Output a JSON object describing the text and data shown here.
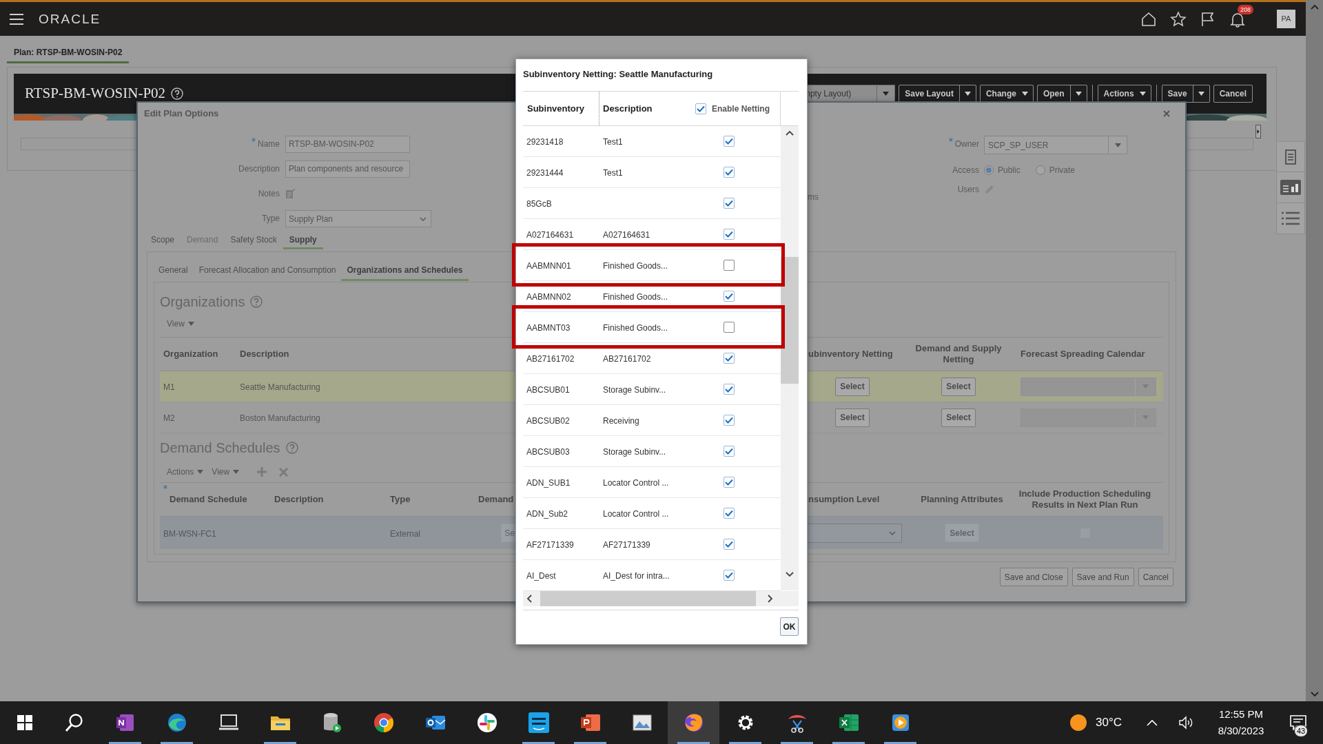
{
  "top_bar": {
    "logo": "ORACLE",
    "notification_count": "208",
    "avatar": "PA"
  },
  "page_tab": {
    "label": "Plan: RTSP-BM-WOSIN-P02",
    "selected": true
  },
  "plan_header": {
    "title": "RTSP-BM-WOSIN-P02",
    "layout_select": "npty Layout)",
    "buttons": [
      {
        "label": "Save Layout",
        "kind": "split",
        "separator_before": false
      },
      {
        "label": "Change",
        "kind": "menu",
        "separator_before": false
      },
      {
        "label": "Open",
        "kind": "split",
        "separator_before": false
      },
      {
        "label": "Actions",
        "kind": "menu",
        "separator_before": true
      },
      {
        "label": "Save",
        "kind": "split",
        "separator_before": true
      },
      {
        "label": "Cancel",
        "kind": "plain",
        "separator_before": false
      }
    ]
  },
  "edit_dialog": {
    "title": "Edit Plan Options",
    "fields": [
      {
        "label": "Name",
        "required": true,
        "kind": "text",
        "value": "RTSP-BM-WOSIN-P02"
      },
      {
        "label": "Description",
        "required": false,
        "kind": "text",
        "value": "Plan components and resource"
      },
      {
        "label": "Notes",
        "required": false,
        "kind": "notes"
      },
      {
        "label": "Type",
        "required": false,
        "kind": "select",
        "value": "Supply Plan"
      }
    ],
    "cut_label": "ms",
    "owner_fields": [
      {
        "label": "Owner",
        "required": true,
        "kind": "combo",
        "value": "SCP_SP_USER"
      },
      {
        "label": "Access",
        "required": false,
        "kind": "radio",
        "options": [
          {
            "label": "Public",
            "selected": true
          },
          {
            "label": "Private",
            "selected": false
          }
        ]
      },
      {
        "label": "Users",
        "required": false,
        "kind": "edit"
      }
    ],
    "tabs": [
      {
        "label": "Scope",
        "selected": false,
        "disabled": false
      },
      {
        "label": "Demand",
        "selected": false,
        "disabled": true
      },
      {
        "label": "Safety Stock",
        "selected": false,
        "disabled": false
      },
      {
        "label": "Supply",
        "selected": true,
        "disabled": false
      }
    ],
    "subtabs": [
      {
        "label": "General",
        "selected": false
      },
      {
        "label": "Forecast Allocation and Consumption",
        "selected": false
      },
      {
        "label": "Organizations and Schedules",
        "selected": true
      }
    ],
    "organizations": {
      "heading": "Organizations",
      "view_menu": "View",
      "columns": [
        "Organization",
        "Description",
        "ubinventory Netting",
        "Demand and Supply Netting",
        "Forecast Spreading Calendar"
      ],
      "rows": [
        {
          "organization": "M1",
          "description": "Seattle Manufacturing",
          "subinventory_netting": "Select",
          "demand_supply_netting": "Select",
          "selected": true
        },
        {
          "organization": "M2",
          "description": "Boston Manufacturing",
          "subinventory_netting": "Select",
          "demand_supply_netting": "Select",
          "selected": false
        }
      ]
    },
    "demand_schedules": {
      "heading": "Demand Schedules",
      "actions_menu": "Actions",
      "view_menu": "View",
      "columns": [
        {
          "label": "Demand Schedule",
          "required": true
        },
        {
          "label": "Description",
          "required": false
        },
        {
          "label": "Type",
          "required": false
        },
        {
          "label": "Demand",
          "required": false
        },
        {
          "label": "nsumption Level",
          "required": false
        },
        {
          "label": "Planning Attributes",
          "required": false
        },
        {
          "label": "Include Production Scheduling Results in Next Plan Run",
          "required": false
        }
      ],
      "rows": [
        {
          "demand_schedule": "BM-WSN-FC1",
          "type": "External",
          "column_4": "Se",
          "planning_attributes": "Select",
          "include_results": false,
          "selected": true
        }
      ]
    },
    "footer_buttons": [
      "Save and Close",
      "Save and Run",
      "Cancel"
    ]
  },
  "netting_dialog": {
    "title": "Subinventory Netting: Seattle Manufacturing",
    "columns": [
      "Subinventory",
      "Description",
      "Enable Netting"
    ],
    "enable_all_checked": true,
    "rows": [
      {
        "subinventory": "29231418",
        "description": "Test1",
        "enabled": true,
        "highlighted": false
      },
      {
        "subinventory": "29231444",
        "description": "Test1",
        "enabled": true,
        "highlighted": false
      },
      {
        "subinventory": "85GcB",
        "enabled": true,
        "highlighted": false
      },
      {
        "subinventory": "A027164631",
        "description": "A027164631",
        "enabled": true,
        "highlighted": false
      },
      {
        "subinventory": "AABMNN01",
        "description": "Finished Goods...",
        "enabled": false,
        "highlighted": true
      },
      {
        "subinventory": "AABMNN02",
        "description": "Finished Goods...",
        "enabled": true,
        "highlighted": false
      },
      {
        "subinventory": "AABMNT03",
        "description": "Finished Goods...",
        "enabled": false,
        "highlighted": true
      },
      {
        "subinventory": "AB27161702",
        "description": "AB27161702",
        "enabled": true,
        "highlighted": false
      },
      {
        "subinventory": "ABCSUB01",
        "description": "Storage Subinv...",
        "enabled": true,
        "highlighted": false
      },
      {
        "subinventory": "ABCSUB02",
        "description": "Receiving",
        "enabled": true,
        "highlighted": false
      },
      {
        "subinventory": "ABCSUB03",
        "description": "Storage Subinv...",
        "enabled": true,
        "highlighted": false
      },
      {
        "subinventory": "ADN_SUB1",
        "description": "Locator Control ...",
        "enabled": true,
        "highlighted": false
      },
      {
        "subinventory": "ADN_Sub2",
        "description": "Locator Control ...",
        "enabled": true,
        "highlighted": false
      },
      {
        "subinventory": "AF27171339",
        "description": "AF27171339",
        "enabled": true,
        "highlighted": false
      },
      {
        "subinventory": "AI_Dest",
        "description": "AI_Dest for intra...",
        "enabled": true,
        "highlighted": false
      }
    ],
    "ok_button": "OK"
  },
  "taskbar": {
    "apps": [
      {
        "kind": "start",
        "running": false,
        "selected": false
      },
      {
        "kind": "search",
        "running": false,
        "selected": false
      },
      {
        "kind": "notes",
        "running": true,
        "selected": false
      },
      {
        "kind": "browser_wave",
        "running": true,
        "selected": false
      },
      {
        "kind": "laptop",
        "running": false,
        "selected": false
      },
      {
        "kind": "folder",
        "running": true,
        "selected": false
      },
      {
        "kind": "database",
        "running": false,
        "selected": false
      },
      {
        "kind": "browser_ring",
        "running": false,
        "selected": false
      },
      {
        "kind": "mail",
        "running": false,
        "selected": false
      },
      {
        "kind": "chat",
        "running": false,
        "selected": false
      },
      {
        "kind": "video",
        "running": true,
        "selected": false
      },
      {
        "kind": "slides",
        "running": true,
        "selected": false
      },
      {
        "kind": "photos",
        "running": false,
        "selected": false
      },
      {
        "kind": "browser_fox",
        "running": true,
        "selected": true
      },
      {
        "kind": "settings",
        "running": true,
        "selected": false
      },
      {
        "kind": "snipping",
        "running": true,
        "selected": false
      },
      {
        "kind": "spreadsheet",
        "running": true,
        "selected": false
      },
      {
        "kind": "player",
        "running": true,
        "selected": false
      }
    ],
    "temperature": "30°C",
    "time": "12:55 PM",
    "date": "8/30/2023",
    "notification_count": "43"
  }
}
